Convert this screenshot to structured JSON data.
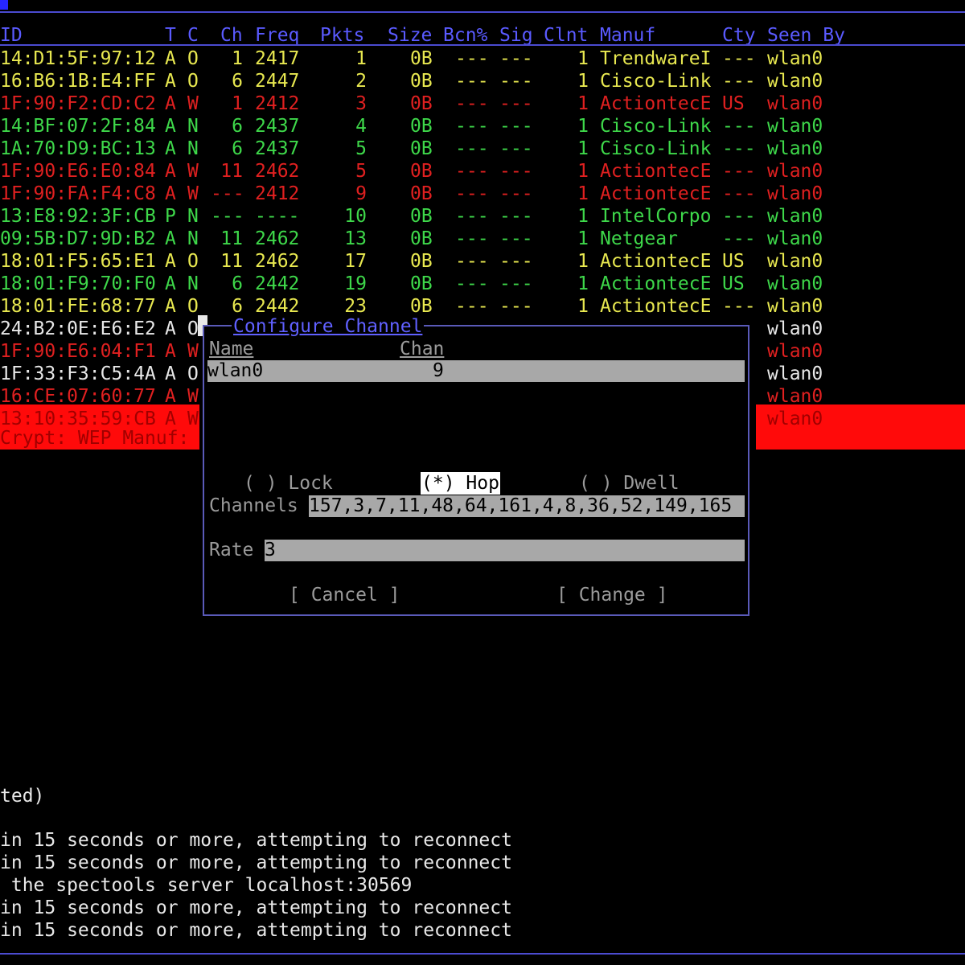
{
  "header": {
    "columns": [
      {
        "key": "bssid",
        "label": "ID"
      },
      {
        "key": "t",
        "label": "T"
      },
      {
        "key": "c",
        "label": "C"
      },
      {
        "key": "ch",
        "label": "Ch"
      },
      {
        "key": "freq",
        "label": "Freq"
      },
      {
        "key": "pkts",
        "label": "Pkts"
      },
      {
        "key": "size",
        "label": "Size"
      },
      {
        "key": "bcn",
        "label": "Bcn%"
      },
      {
        "key": "sig",
        "label": "Sig"
      },
      {
        "key": "clnt",
        "label": "Clnt"
      },
      {
        "key": "manuf",
        "label": "Manuf"
      },
      {
        "key": "cty",
        "label": "Cty"
      },
      {
        "key": "seen",
        "label": "Seen By"
      }
    ]
  },
  "colors": {
    "yellow": "#e8e850",
    "red": "#e02020",
    "green": "#3ed84a",
    "accent": "#5a5aff",
    "selected_bg": "#ff0a0a"
  },
  "rows": [
    {
      "color": "yellow",
      "bssid": "14:D1:5F:97:12",
      "t": "A",
      "c": "O",
      "ch": "1",
      "freq": "2417",
      "pkts": "1",
      "size": "0B",
      "bcn": "---",
      "sig": "---",
      "clnt": "1",
      "manuf": "TrendwareI",
      "cty": "---",
      "seen": "wlan0"
    },
    {
      "color": "yellow",
      "bssid": "16:B6:1B:E4:FF",
      "t": "A",
      "c": "O",
      "ch": "6",
      "freq": "2447",
      "pkts": "2",
      "size": "0B",
      "bcn": "---",
      "sig": "---",
      "clnt": "1",
      "manuf": "Cisco-Link",
      "cty": "---",
      "seen": "wlan0"
    },
    {
      "color": "red",
      "bssid": "1F:90:F2:CD:C2",
      "t": "A",
      "c": "W",
      "ch": "1",
      "freq": "2412",
      "pkts": "3",
      "size": "0B",
      "bcn": "---",
      "sig": "---",
      "clnt": "1",
      "manuf": "ActiontecE",
      "cty": "US",
      "seen": "wlan0"
    },
    {
      "color": "green",
      "bssid": "14:BF:07:2F:84",
      "t": "A",
      "c": "N",
      "ch": "6",
      "freq": "2437",
      "pkts": "4",
      "size": "0B",
      "bcn": "---",
      "sig": "---",
      "clnt": "1",
      "manuf": "Cisco-Link",
      "cty": "---",
      "seen": "wlan0"
    },
    {
      "color": "green",
      "bssid": "1A:70:D9:BC:13",
      "t": "A",
      "c": "N",
      "ch": "6",
      "freq": "2437",
      "pkts": "5",
      "size": "0B",
      "bcn": "---",
      "sig": "---",
      "clnt": "1",
      "manuf": "Cisco-Link",
      "cty": "---",
      "seen": "wlan0"
    },
    {
      "color": "red",
      "bssid": "1F:90:E6:E0:84",
      "t": "A",
      "c": "W",
      "ch": "11",
      "freq": "2462",
      "pkts": "5",
      "size": "0B",
      "bcn": "---",
      "sig": "---",
      "clnt": "1",
      "manuf": "ActiontecE",
      "cty": "---",
      "seen": "wlan0"
    },
    {
      "color": "red",
      "bssid": "1F:90:FA:F4:C8",
      "t": "A",
      "c": "W",
      "ch": "---",
      "freq": "2412",
      "pkts": "9",
      "size": "0B",
      "bcn": "---",
      "sig": "---",
      "clnt": "1",
      "manuf": "ActiontecE",
      "cty": "---",
      "seen": "wlan0"
    },
    {
      "color": "green",
      "bssid": "13:E8:92:3F:CB",
      "t": "P",
      "c": "N",
      "ch": "---",
      "freq": "----",
      "pkts": "10",
      "size": "0B",
      "bcn": "---",
      "sig": "---",
      "clnt": "1",
      "manuf": "IntelCorpo",
      "cty": "---",
      "seen": "wlan0"
    },
    {
      "color": "green",
      "bssid": "09:5B:D7:9D:B2",
      "t": "A",
      "c": "N",
      "ch": "11",
      "freq": "2462",
      "pkts": "13",
      "size": "0B",
      "bcn": "---",
      "sig": "---",
      "clnt": "1",
      "manuf": "Netgear",
      "cty": "---",
      "seen": "wlan0"
    },
    {
      "color": "yellow",
      "bssid": "18:01:F5:65:E1",
      "t": "A",
      "c": "O",
      "ch": "11",
      "freq": "2462",
      "pkts": "17",
      "size": "0B",
      "bcn": "---",
      "sig": "---",
      "clnt": "1",
      "manuf": "ActiontecE",
      "cty": "US",
      "seen": "wlan0"
    },
    {
      "color": "green",
      "bssid": "18:01:F9:70:F0",
      "t": "A",
      "c": "N",
      "ch": "6",
      "freq": "2442",
      "pkts": "19",
      "size": "0B",
      "bcn": "---",
      "sig": "---",
      "clnt": "1",
      "manuf": "ActiontecE",
      "cty": "US",
      "seen": "wlan0"
    },
    {
      "color": "yellow",
      "bssid": "18:01:FE:68:77",
      "t": "A",
      "c": "O",
      "ch": "6",
      "freq": "2442",
      "pkts": "23",
      "size": "0B",
      "bcn": "---",
      "sig": "---",
      "clnt": "1",
      "manuf": "ActiontecE",
      "cty": "---",
      "seen": "wlan0"
    },
    {
      "color": "white",
      "bssid": "24:B2:0E:E6:E2",
      "t": "A",
      "c": "O",
      "seen": "wlan0"
    },
    {
      "color": "red",
      "bssid": "1F:90:E6:04:F1",
      "t": "A",
      "c": "W",
      "seen": "wlan0"
    },
    {
      "color": "white",
      "bssid": "1F:33:F3:C5:4A",
      "t": "A",
      "c": "O",
      "seen": "wlan0"
    },
    {
      "color": "red",
      "bssid": "16:CE:07:60:77",
      "t": "A",
      "c": "W",
      "seen": "wlan0"
    },
    {
      "color": "selected",
      "bssid": "13:10:35:59:CB",
      "t": "A",
      "c": "W",
      "seen": "wlan0"
    }
  ],
  "selected_detail": "Crypt: WEP Manuf:",
  "dialog": {
    "title": "Configure Channel",
    "col_name": "Name",
    "col_chan": "Chan",
    "source_name": "wlan0",
    "source_chan": "9",
    "radio_lock": "( ) Lock",
    "radio_hop": "(*) Hop",
    "radio_dwell": "( ) Dwell",
    "channels_label": "Channels",
    "channels_value": "157,3,7,11,48,64,161,4,8,36,52,149,165",
    "rate_label": "Rate",
    "rate_value": "3",
    "cancel": "[ Cancel ]",
    "change": "[ Change ]"
  },
  "log": [
    "ted)",
    "in 15 seconds or more, attempting to reconnect",
    "in 15 seconds or more, attempting to reconnect",
    " the spectools server localhost:30569",
    "in 15 seconds or more, attempting to reconnect",
    "in 15 seconds or more, attempting to reconnect"
  ]
}
